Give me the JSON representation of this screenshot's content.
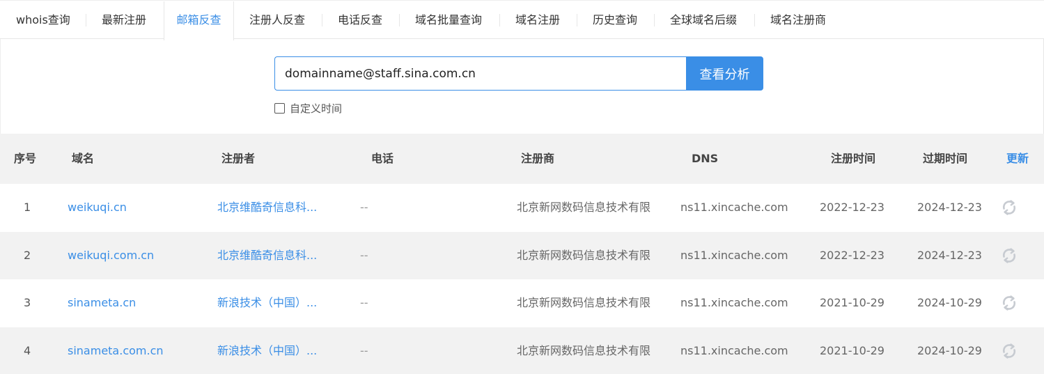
{
  "tabs": [
    {
      "label": "whois查询"
    },
    {
      "label": "最新注册"
    },
    {
      "label": "邮箱反查"
    },
    {
      "label": "注册人反查"
    },
    {
      "label": "电话反查"
    },
    {
      "label": "域名批量查询"
    },
    {
      "label": "域名注册"
    },
    {
      "label": "历史查询"
    },
    {
      "label": "全球域名后缀"
    },
    {
      "label": "域名注册商"
    }
  ],
  "search": {
    "value": "domainname@staff.sina.com.cn",
    "button_label": "查看分析",
    "custom_time_label": "自定义时间"
  },
  "table": {
    "headers": {
      "index": "序号",
      "domain": "域名",
      "registrant": "注册者",
      "phone": "电话",
      "registrar": "注册商",
      "dns": "DNS",
      "reg_date": "注册时间",
      "exp_date": "过期时间",
      "refresh": "更新"
    },
    "rows": [
      {
        "index": "1",
        "domain": "weikuqi.cn",
        "registrant": "北京维酷奇信息科...",
        "phone": "--",
        "registrar": "北京新网数码信息技术有限",
        "dns": "ns11.xincache.com",
        "reg_date": "2022-12-23",
        "exp_date": "2024-12-23"
      },
      {
        "index": "2",
        "domain": "weikuqi.com.cn",
        "registrant": "北京维酷奇信息科...",
        "phone": "--",
        "registrar": "北京新网数码信息技术有限",
        "dns": "ns11.xincache.com",
        "reg_date": "2022-12-23",
        "exp_date": "2024-12-23"
      },
      {
        "index": "3",
        "domain": "sinameta.cn",
        "registrant": "新浪技术（中国）...",
        "phone": "--",
        "registrar": "北京新网数码信息技术有限",
        "dns": "ns11.xincache.com",
        "reg_date": "2021-10-29",
        "exp_date": "2024-10-29"
      },
      {
        "index": "4",
        "domain": "sinameta.com.cn",
        "registrant": "新浪技术（中国）...",
        "phone": "--",
        "registrar": "北京新网数码信息技术有限",
        "dns": "ns11.xincache.com",
        "reg_date": "2021-10-29",
        "exp_date": "2024-10-29"
      }
    ]
  },
  "colors": {
    "accent": "#3a8ee6",
    "header_bg": "#f2f2f2"
  }
}
